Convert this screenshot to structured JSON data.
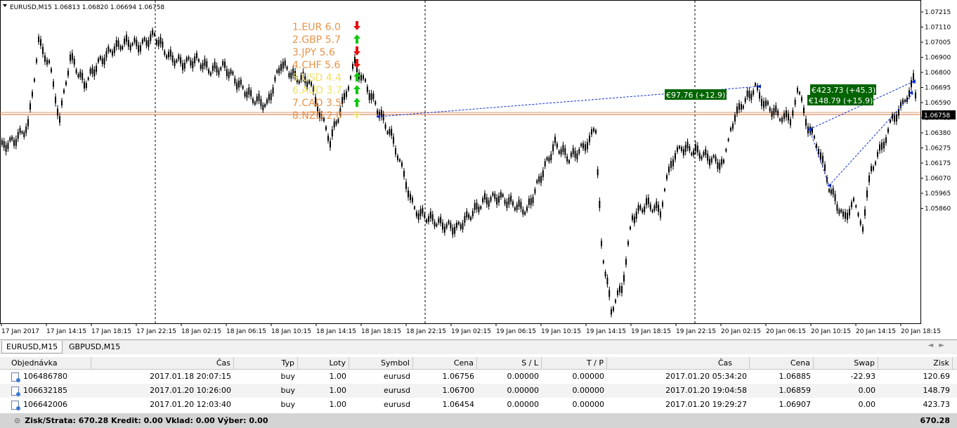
{
  "chart": {
    "header": "EURUSD,M15  1.06813 1.06820 1.06694 1.06758",
    "price_scale": [
      "1.07215",
      "1.07110",
      "1.07005",
      "1.06900",
      "1.06800",
      "1.06695",
      "1.06590",
      "1.06485",
      "1.06380",
      "1.06275",
      "1.06175",
      "1.06070",
      "1.05965",
      "1.05860"
    ],
    "current_price": "1.06758",
    "time_scale": [
      "17 Jan 2017",
      "17 Jan 14:15",
      "17 Jan 18:15",
      "17 Jan 22:15",
      "18 Jan 02:15",
      "18 Jan 06:15",
      "18 Jan 10:15",
      "18 Jan 14:15",
      "18 Jan 18:15",
      "18 Jan 22:15",
      "19 Jan 02:15",
      "19 Jan 06:15",
      "19 Jan 10:15",
      "19 Jan 14:15",
      "19 Jan 18:15",
      "19 Jan 22:15",
      "20 Jan 02:15",
      "20 Jan 06:15",
      "20 Jan 10:15",
      "20 Jan 14:15",
      "20 Jan 18:15"
    ],
    "strength": [
      {
        "text": "1.EUR  6.0",
        "color": "#e8944a",
        "arrow": "down",
        "arrow_color": "#e81010"
      },
      {
        "text": "2.GBP  5.7",
        "color": "#e8944a",
        "arrow": "up",
        "arrow_color": "#10c810"
      },
      {
        "text": "3.JPY   5.6",
        "color": "#e8944a",
        "arrow": "down",
        "arrow_color": "#e81010"
      },
      {
        "text": "4.CHF  5.6",
        "color": "#e8944a",
        "arrow": "down",
        "arrow_color": "#e81010"
      },
      {
        "text": "5.USD  4.4",
        "color": "#f0e060",
        "arrow": "up",
        "arrow_color": "#10c810"
      },
      {
        "text": "6.AUD  3.7",
        "color": "#f0e060",
        "arrow": "up",
        "arrow_color": "#10c810"
      },
      {
        "text": "7.CAD  3.5",
        "color": "#e8944a",
        "arrow": "up",
        "arrow_color": "#10c810"
      },
      {
        "text": "8.NZD  2.0",
        "color": "#e8944a",
        "arrow": "neutral",
        "arrow_color": "#f0e060"
      }
    ],
    "trade_labels": [
      "€97.76 (+12.9)",
      "€423.73 (+45.3)",
      "€148.79 (+15.9)"
    ],
    "colors": {
      "bar": "#000000",
      "price_line": "#d0703a",
      "trade_line": "#1030d0",
      "label_bg": "#006400"
    }
  },
  "tabs": [
    {
      "label": "EURUSD,M15",
      "active": true
    },
    {
      "label": "GBPUSD,M15",
      "active": false
    }
  ],
  "table": {
    "headers": [
      "Objednávka",
      "Čas",
      "Typ",
      "Loty",
      "Symbol",
      "Cena",
      "S / L",
      "T / P",
      "Čas",
      "Cena",
      "Swap",
      "Zisk"
    ],
    "rows": [
      [
        "106486780",
        "2017.01.18 20:07:15",
        "buy",
        "1.00",
        "eurusd",
        "1.06756",
        "0.00000",
        "0.00000",
        "2017.01.20 05:34:20",
        "1.06885",
        "-22.93",
        "120.69"
      ],
      [
        "106632185",
        "2017.01.20 10:26:00",
        "buy",
        "1.00",
        "eurusd",
        "1.06700",
        "0.00000",
        "0.00000",
        "2017.01.20 19:04:58",
        "1.06859",
        "0.00",
        "148.79"
      ],
      [
        "106642006",
        "2017.01.20 12:03:40",
        "buy",
        "1.00",
        "eurusd",
        "1.06454",
        "0.00000",
        "0.00000",
        "2017.01.20 19:29:27",
        "1.06907",
        "0.00",
        "423.73"
      ]
    ],
    "footer_summary": "Zisk/Strata: 670.28  Kredit: 0.00  Vklad: 0.00  Výber: 0.00",
    "footer_total": "670.28"
  }
}
